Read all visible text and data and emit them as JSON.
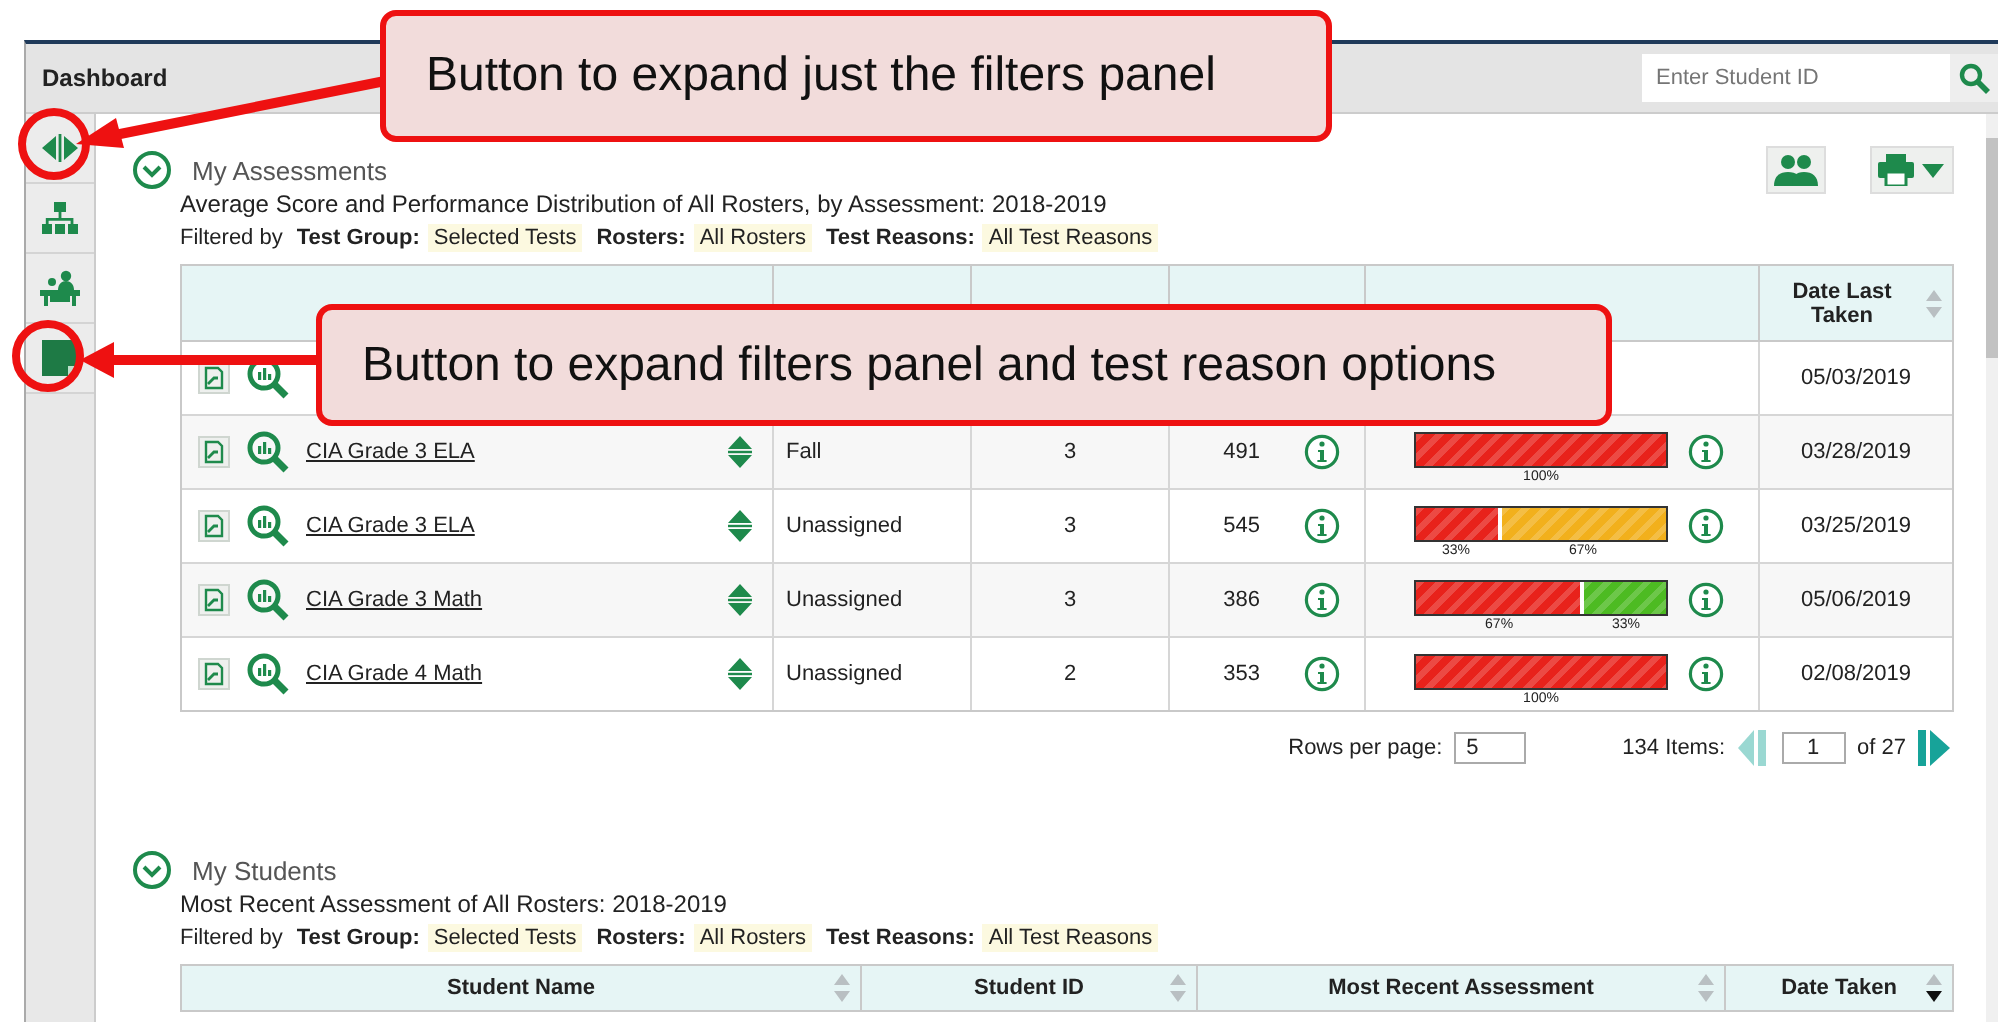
{
  "header": {
    "title": "Dashboard",
    "search": {
      "placeholder": "Enter Student ID"
    }
  },
  "sidebar": {
    "items": [
      {
        "kind": "expand"
      },
      {
        "kind": "hierarchy"
      },
      {
        "kind": "teacher"
      },
      {
        "kind": "panel"
      }
    ]
  },
  "assessments": {
    "title": "My Assessments",
    "subtitle": "Average Score and Performance Distribution of All Rosters, by Assessment: 2018-2019",
    "filters": {
      "lead": "Filtered by",
      "items": [
        {
          "label": "Test Group:",
          "value": "Selected Tests"
        },
        {
          "label": "Rosters:",
          "value": "All Rosters"
        },
        {
          "label": "Test Reasons:",
          "value": "All Test Reasons"
        }
      ]
    },
    "date_column": "Date Last Taken",
    "rows": [
      {
        "name": "",
        "reason": "",
        "count": "",
        "score": "",
        "segments": [],
        "date": "05/03/2019"
      },
      {
        "name": "CIA Grade 3 ELA",
        "reason": "Fall",
        "count": "3",
        "score": "491",
        "segments": [
          {
            "level": 1,
            "color": "#e8221b",
            "label": "100%"
          }
        ],
        "date": "03/28/2019"
      },
      {
        "name": "CIA Grade 3 ELA",
        "reason": "Unassigned",
        "count": "3",
        "score": "545",
        "segments": [
          {
            "level": 0.33,
            "color": "#e8221b",
            "label": "33%"
          },
          {
            "level": 0.67,
            "color": "#f2b01c",
            "label": "67%"
          }
        ],
        "date": "03/25/2019"
      },
      {
        "name": "CIA Grade 3 Math",
        "reason": "Unassigned",
        "count": "3",
        "score": "386",
        "segments": [
          {
            "level": 0.67,
            "color": "#e8221b",
            "label": "67%"
          },
          {
            "level": 0.33,
            "color": "#4dbb22",
            "label": "33%"
          }
        ],
        "date": "05/06/2019"
      },
      {
        "name": "CIA Grade 4 Math",
        "reason": "Unassigned",
        "count": "2",
        "score": "353",
        "segments": [
          {
            "level": 1,
            "color": "#e8221b",
            "label": "100%"
          }
        ],
        "date": "02/08/2019"
      }
    ],
    "pagination": {
      "rows_label": "Rows per page:",
      "rows_value": "5",
      "items": "134 Items:",
      "page": "1",
      "of": "of 27"
    }
  },
  "students": {
    "title": "My Students",
    "subtitle": "Most Recent Assessment of All Rosters: 2018-2019",
    "filters": {
      "lead": "Filtered by",
      "items": [
        {
          "label": "Test Group:",
          "value": "Selected Tests"
        },
        {
          "label": "Rosters:",
          "value": "All Rosters"
        },
        {
          "label": "Test Reasons:",
          "value": "All Test Reasons"
        }
      ]
    },
    "columns": [
      {
        "label": "Student Name",
        "sorted": false
      },
      {
        "label": "Student ID",
        "sorted": false
      },
      {
        "label": "Most Recent Assessment",
        "sorted": false
      },
      {
        "label": "Date Taken",
        "sorted": true
      }
    ]
  },
  "callouts": [
    {
      "text": "Button to expand just the filters panel"
    },
    {
      "text": "Button to expand filters panel and test reason options"
    }
  ]
}
